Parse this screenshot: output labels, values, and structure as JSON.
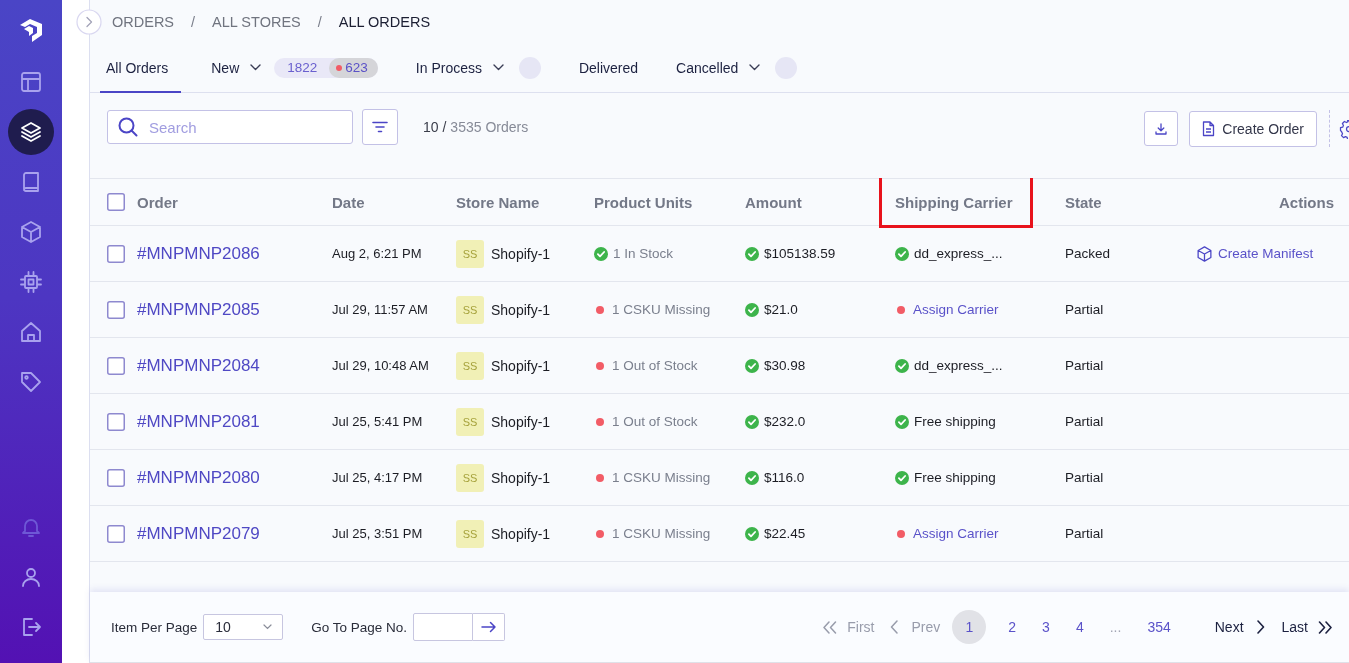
{
  "sidebar": {
    "items": [
      {
        "selected": false,
        "dimmed": false
      },
      {
        "selected": true,
        "dimmed": false
      },
      {
        "selected": false,
        "dimmed": false
      },
      {
        "selected": false,
        "dimmed": false
      },
      {
        "selected": false,
        "dimmed": false
      },
      {
        "selected": false,
        "dimmed": false
      },
      {
        "selected": false,
        "dimmed": false
      }
    ],
    "bottom_items": [
      {
        "selected": false,
        "dimmed": true
      },
      {
        "selected": false,
        "dimmed": false
      },
      {
        "selected": false,
        "dimmed": false
      }
    ]
  },
  "breadcrumb": [
    {
      "kind": "link",
      "text": "ORDERS"
    },
    {
      "kind": "separator",
      "text": "/"
    },
    {
      "kind": "link",
      "text": "ALL STORES"
    },
    {
      "kind": "separator",
      "text": "/"
    },
    {
      "kind": "current",
      "text": "ALL ORDERS"
    }
  ],
  "tabs": [
    {
      "label": "All Orders",
      "selected": true,
      "dropdown": false,
      "badge": false
    },
    {
      "label": "New",
      "selected": false,
      "dropdown": true,
      "badge": false,
      "counts": [
        {
          "text": "1822",
          "alert": false
        },
        {
          "text": "623",
          "alert": true
        }
      ]
    },
    {
      "label": "In Process",
      "selected": false,
      "dropdown": true,
      "badge": true
    },
    {
      "label": "Delivered",
      "selected": false,
      "dropdown": false,
      "badge": false
    },
    {
      "label": "Cancelled",
      "selected": false,
      "dropdown": true,
      "badge": true
    }
  ],
  "toolbar": {
    "search": {
      "placeholder": "Search"
    },
    "shown": "10 /",
    "total": "3535 Orders",
    "create_button": "Create Order"
  },
  "table": {
    "select_all": {
      "checked": false
    },
    "columns": [
      {
        "label": "Order",
        "highlighted": false
      },
      {
        "label": "Date",
        "highlighted": false
      },
      {
        "label": "Store Name",
        "highlighted": false
      },
      {
        "label": "Product Units",
        "highlighted": false
      },
      {
        "label": "Amount",
        "highlighted": false
      },
      {
        "label": "Shipping Carrier",
        "highlighted": true
      },
      {
        "label": "State",
        "highlighted": false
      },
      {
        "label": "Actions",
        "highlighted": false
      }
    ],
    "rows": [
      {
        "checked": false,
        "order": "#MNPMNP2086",
        "date": "Aug 2, 6:21 PM",
        "store_initials": "SS",
        "store": "Shopify-1",
        "units": {
          "text": "1 In Stock",
          "alert": false
        },
        "amount": {
          "text": "$105138.59",
          "alert": false
        },
        "carrier": {
          "text": "dd_express_...",
          "alert": false,
          "kind": "text"
        },
        "state": "Packed",
        "action": "Create Manifest"
      },
      {
        "checked": false,
        "order": "#MNPMNP2085",
        "date": "Jul 29, 11:57 AM",
        "store_initials": "SS",
        "store": "Shopify-1",
        "units": {
          "text": "1 CSKU Missing",
          "alert": true
        },
        "amount": {
          "text": "$21.0",
          "alert": false
        },
        "carrier": {
          "text": "Assign Carrier",
          "alert": true,
          "kind": "link"
        },
        "state": "Partial"
      },
      {
        "checked": false,
        "order": "#MNPMNP2084",
        "date": "Jul 29, 10:48 AM",
        "store_initials": "SS",
        "store": "Shopify-1",
        "units": {
          "text": "1 Out of Stock",
          "alert": true
        },
        "amount": {
          "text": "$30.98",
          "alert": false
        },
        "carrier": {
          "text": "dd_express_...",
          "alert": false,
          "kind": "text"
        },
        "state": "Partial"
      },
      {
        "checked": false,
        "order": "#MNPMNP2081",
        "date": "Jul 25, 5:41 PM",
        "store_initials": "SS",
        "store": "Shopify-1",
        "units": {
          "text": "1 Out of Stock",
          "alert": true
        },
        "amount": {
          "text": "$232.0",
          "alert": false
        },
        "carrier": {
          "text": "Free shipping",
          "alert": false,
          "kind": "text"
        },
        "state": "Partial"
      },
      {
        "checked": false,
        "order": "#MNPMNP2080",
        "date": "Jul 25, 4:17 PM",
        "store_initials": "SS",
        "store": "Shopify-1",
        "units": {
          "text": "1 CSKU Missing",
          "alert": true
        },
        "amount": {
          "text": "$116.0",
          "alert": false
        },
        "carrier": {
          "text": "Free shipping",
          "alert": false,
          "kind": "text"
        },
        "state": "Partial"
      },
      {
        "checked": false,
        "order": "#MNPMNP2079",
        "date": "Jul 25, 3:51 PM",
        "store_initials": "SS",
        "store": "Shopify-1",
        "units": {
          "text": "1 CSKU Missing",
          "alert": true
        },
        "amount": {
          "text": "$22.45",
          "alert": false
        },
        "carrier": {
          "text": "Assign Carrier",
          "alert": true,
          "kind": "link"
        },
        "state": "Partial"
      }
    ]
  },
  "footer": {
    "per_page": {
      "label": "Item Per Page",
      "value": "10"
    },
    "goto": {
      "label": "Go To Page No."
    },
    "pagination": {
      "first": {
        "label": "First",
        "disabled": true
      },
      "prev": {
        "label": "Prev",
        "disabled": true
      },
      "pages": [
        {
          "label": "1",
          "kind": "page",
          "selected": true
        },
        {
          "label": "2",
          "kind": "page",
          "selected": false
        },
        {
          "label": "3",
          "kind": "page",
          "selected": false
        },
        {
          "label": "4",
          "kind": "page",
          "selected": false
        },
        {
          "label": "...",
          "kind": "gap",
          "selected": false
        },
        {
          "label": "354",
          "kind": "page",
          "selected": false
        }
      ],
      "next": {
        "label": "Next",
        "disabled": false
      },
      "last": {
        "label": "Last",
        "disabled": false
      }
    }
  }
}
